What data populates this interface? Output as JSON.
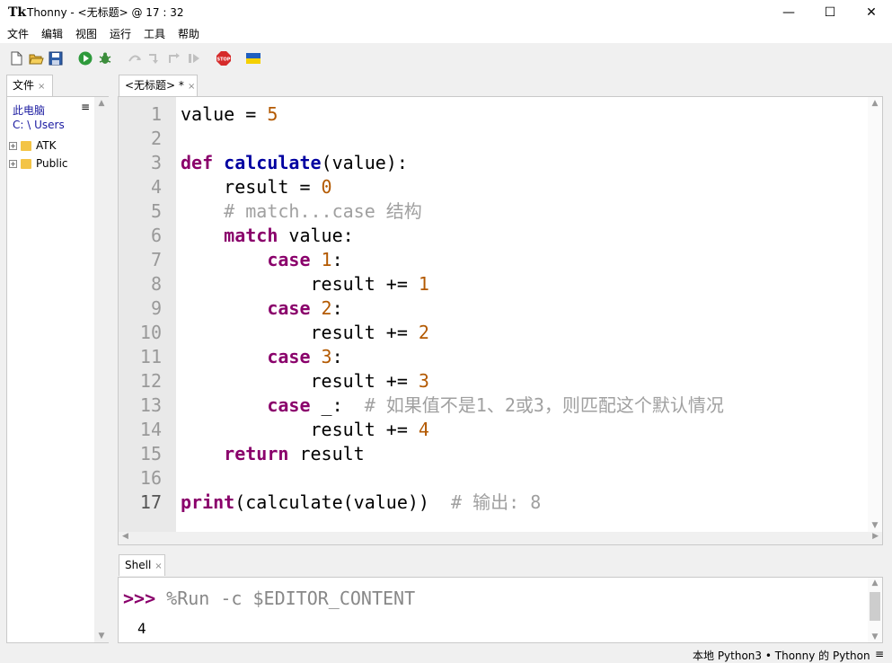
{
  "window": {
    "app_icon": "Tk",
    "title": "Thonny  -  <无标题>  @  17 : 32",
    "min": "—",
    "max": "☐",
    "close": "✕"
  },
  "menu": [
    "文件",
    "编辑",
    "视图",
    "运行",
    "工具",
    "帮助"
  ],
  "toolbar_icons": [
    "new-file-icon",
    "open-file-icon",
    "save-icon",
    "run-icon",
    "debug-icon",
    "step-over-icon",
    "step-into-icon",
    "step-out-icon",
    "resume-icon",
    "stop-icon",
    "ukraine-flag-icon"
  ],
  "files_panel": {
    "tab_label": "文件",
    "tab_close": "×",
    "location_root": "此电脑",
    "location_path": "C: \\ Users",
    "menu_glyph": "≡",
    "items": [
      {
        "name": "ATK"
      },
      {
        "name": "Public"
      }
    ]
  },
  "editor": {
    "tab_label": "<无标题> *",
    "tab_close": "×",
    "current_line": 17
  },
  "shell": {
    "tab_label": "Shell",
    "tab_close": "×",
    "prompt": ">>>",
    "command": "%Run -c $EDITOR_CONTENT",
    "output": "4"
  },
  "status": {
    "text": "本地 Python3  •  Thonny 的 Python",
    "menu_glyph": "≡"
  },
  "colors": {
    "keyword": "#8a006b",
    "function": "#0000a0",
    "number": "#b35900",
    "comment": "#a0a0a0",
    "prompt": "#8a006b"
  }
}
